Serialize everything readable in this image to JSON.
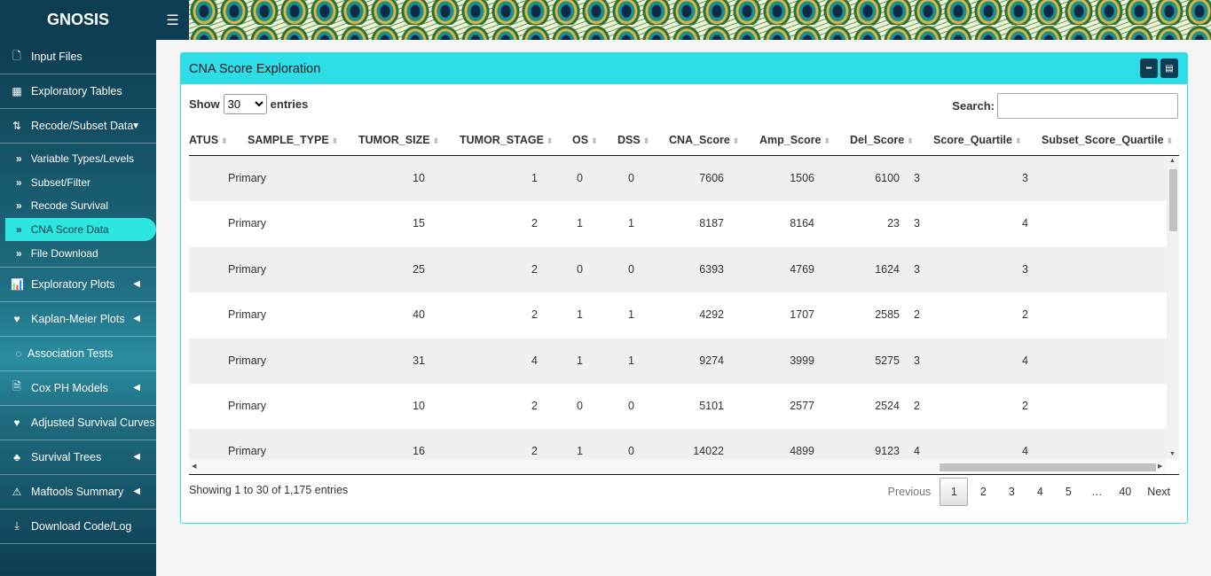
{
  "app": {
    "title": "GNOSIS",
    "menu_icon": "hamburger-icon"
  },
  "sidebar": {
    "items": [
      {
        "label": "Input Files",
        "icon": "file-icon"
      },
      {
        "label": "Exploratory Tables",
        "icon": "table-icon"
      },
      {
        "label": "Recode/Subset Data",
        "icon": "sort-icon",
        "expanded": true,
        "sub": [
          {
            "label": "Variable Types/Levels"
          },
          {
            "label": "Subset/Filter"
          },
          {
            "label": "Recode Survival"
          },
          {
            "label": "CNA Score Data",
            "active": true
          },
          {
            "label": "File Download"
          }
        ]
      },
      {
        "label": "Exploratory Plots",
        "icon": "bar-chart-icon"
      },
      {
        "label": "Kaplan-Meier Plots",
        "icon": "heartbeat-icon"
      },
      {
        "label": "Association Tests",
        "icon": "circle-icon"
      },
      {
        "label": "Cox PH Models",
        "icon": "file-icon"
      },
      {
        "label": "Adjusted Survival Curves",
        "icon": "heartbeat-icon"
      },
      {
        "label": "Survival Trees",
        "icon": "tree-icon"
      },
      {
        "label": "Maftools Summary",
        "icon": "warning-icon"
      },
      {
        "label": "Download Code/Log",
        "icon": "download-file-icon"
      }
    ]
  },
  "box": {
    "title": "CNA Score Exploration"
  },
  "controls": {
    "show_label": "Show",
    "entries_label": "entries",
    "page_size": "30",
    "search_label": "Search:",
    "search_value": ""
  },
  "table": {
    "columns": [
      "ATUS",
      "SAMPLE_TYPE",
      "TUMOR_SIZE",
      "TUMOR_STAGE",
      "OS",
      "DSS",
      "CNA_Score",
      "Amp_Score",
      "Del_Score",
      "Score_Quartile",
      "Subset_Score_Quartile"
    ],
    "rows": [
      [
        "",
        "Primary",
        "10",
        "1",
        "0",
        "0",
        "7606",
        "1506",
        "6100",
        "3",
        "3"
      ],
      [
        "",
        "Primary",
        "15",
        "2",
        "1",
        "1",
        "8187",
        "8164",
        "23",
        "3",
        "4"
      ],
      [
        "",
        "Primary",
        "25",
        "2",
        "0",
        "0",
        "6393",
        "4769",
        "1624",
        "3",
        "3"
      ],
      [
        "",
        "Primary",
        "40",
        "2",
        "1",
        "1",
        "4292",
        "1707",
        "2585",
        "2",
        "2"
      ],
      [
        "",
        "Primary",
        "31",
        "4",
        "1",
        "1",
        "9274",
        "3999",
        "5275",
        "3",
        "4"
      ],
      [
        "",
        "Primary",
        "10",
        "2",
        "0",
        "0",
        "5101",
        "2577",
        "2524",
        "2",
        "2"
      ],
      [
        "",
        "Primary",
        "16",
        "2",
        "1",
        "0",
        "14022",
        "4899",
        "9123",
        "4",
        "4"
      ]
    ]
  },
  "footer": {
    "info": "Showing 1 to 30 of 1,175 entries",
    "pages": [
      "Previous",
      "1",
      "2",
      "3",
      "4",
      "5",
      "…",
      "40",
      "Next"
    ],
    "active_page": "1"
  }
}
